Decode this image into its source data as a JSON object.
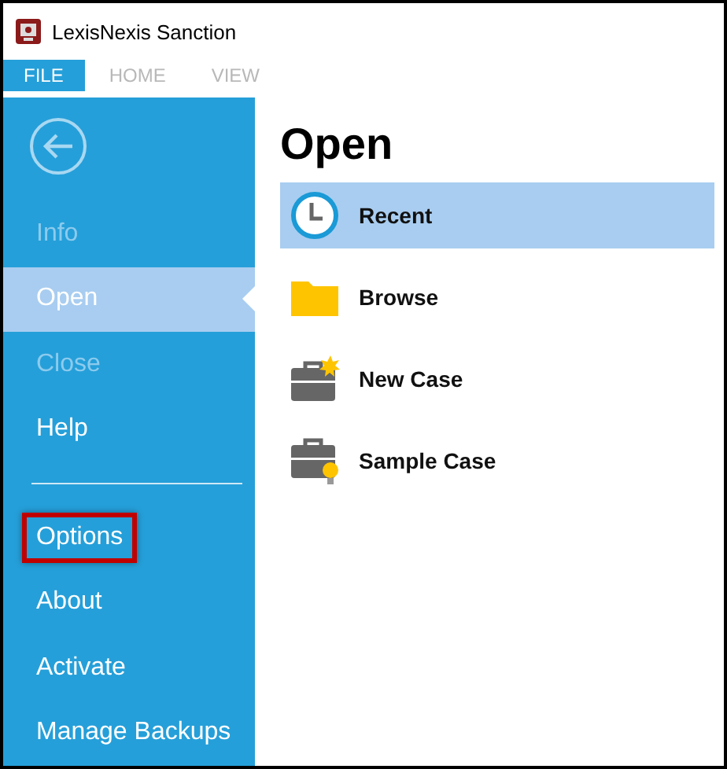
{
  "window": {
    "title": "LexisNexis Sanction"
  },
  "tabs": [
    {
      "label": "FILE",
      "selected": true
    },
    {
      "label": "HOME",
      "selected": false
    },
    {
      "label": "VIEW",
      "selected": false
    }
  ],
  "sidebar": {
    "primary_items": [
      {
        "label": "Info",
        "selected": false,
        "disabled": true,
        "highlighted": false
      },
      {
        "label": "Open",
        "selected": true,
        "disabled": false,
        "highlighted": false
      },
      {
        "label": "Close",
        "selected": false,
        "disabled": true,
        "highlighted": false
      },
      {
        "label": "Help",
        "selected": false,
        "disabled": false,
        "highlighted": false
      }
    ],
    "secondary_items": [
      {
        "label": "Options",
        "selected": false,
        "disabled": false,
        "highlighted": true
      },
      {
        "label": "About",
        "selected": false,
        "disabled": false,
        "highlighted": false
      },
      {
        "label": "Activate",
        "selected": false,
        "disabled": false,
        "highlighted": false
      },
      {
        "label": "Manage Backups",
        "selected": false,
        "disabled": false,
        "highlighted": false
      }
    ]
  },
  "main": {
    "heading": "Open",
    "options": [
      {
        "label": "Recent",
        "kind": "recent",
        "selected": true
      },
      {
        "label": "Browse",
        "kind": "browse",
        "selected": false
      },
      {
        "label": "New Case",
        "kind": "new-case",
        "selected": false
      },
      {
        "label": "Sample Case",
        "kind": "sample-case",
        "selected": false
      }
    ]
  }
}
